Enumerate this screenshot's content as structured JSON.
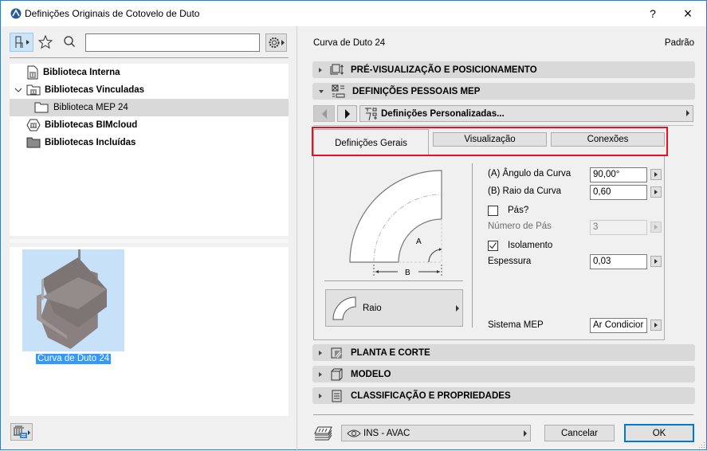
{
  "window": {
    "title": "Definições Originais de Cotovelo de Duto",
    "help": "?",
    "close": "×"
  },
  "library": {
    "search_placeholder": "",
    "tree": [
      {
        "label": "Biblioteca Interna",
        "icon": "library-document-icon"
      },
      {
        "label": "Bibliotecas Vinculadas",
        "icon": "linked-library-folder-icon",
        "expanded": true
      },
      {
        "label": "Biblioteca MEP 24",
        "icon": "folder-icon",
        "selected": true
      },
      {
        "label": "Bibliotecas BIMcloud",
        "icon": "bimcloud-library-icon"
      },
      {
        "label": "Bibliotecas Incluídas",
        "icon": "filled-folder-icon"
      }
    ],
    "preview_item": "Curva de Duto 24"
  },
  "settings": {
    "object_name": "Curva de Duto 24",
    "preset": "Padrão",
    "sections": {
      "preview": "PRÉ-VISUALIZAÇÃO E POSICIONAMENTO",
      "mep": "DEFINIÇÕES PESSOAIS MEP",
      "plan": "PLANTA E CORTE",
      "model": "MODELO",
      "classification": "CLASSIFICAÇÃO E PROPRIEDADES"
    },
    "custom_dropdown": "Definições Personalizadas...",
    "tabs": [
      "Definições Gerais",
      "Visualização",
      "Conexões"
    ],
    "active_tab": "Definições Gerais",
    "diagram": {
      "a": "A",
      "b": "B"
    },
    "shape_button": "Raio",
    "fields": {
      "angle_label": "(A) Ângulo da Curva",
      "angle_value": "90,00°",
      "radius_label": "(B) Raio da Curva",
      "radius_value": "0,60",
      "vanes_label": "Pás?",
      "vanes_checked": false,
      "vane_count_label": "Número de Pás",
      "vane_count_value": "3",
      "insulation_label": "Isolamento",
      "insulation_checked": true,
      "thickness_label": "Espessura",
      "thickness_value": "0,03",
      "system_label": "Sistema MEP",
      "system_value": "Ar Condicior"
    },
    "highlight_color": "#e81123"
  },
  "footer": {
    "layer": "INS - AVAC",
    "cancel": "Cancelar",
    "ok": "OK"
  }
}
